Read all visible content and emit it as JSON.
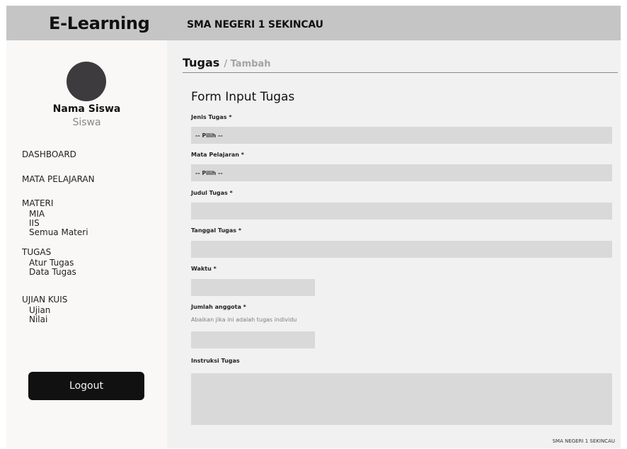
{
  "header": {
    "brand": "E-Learning",
    "school_name": "SMA NEGERI 1 SEKINCAU"
  },
  "sidebar": {
    "user_name": "Nama Siswa",
    "user_role": "Siswa",
    "menu": {
      "dashboard": "DASHBOARD",
      "mata_pelajaran": "MATA PELAJARAN",
      "materi": {
        "label": "MATERI",
        "items": [
          "MIA",
          "IIS",
          "Semua Materi"
        ]
      },
      "tugas": {
        "label": "TUGAS",
        "items": [
          "Atur Tugas",
          "Data Tugas"
        ]
      },
      "ujian_kuis": {
        "label": "UJIAN KUIS",
        "items": [
          "Ujian",
          "Nilai"
        ]
      }
    },
    "logout_label": "Logout"
  },
  "main": {
    "breadcrumb": {
      "current": "Tugas",
      "sub": "/ Tambah"
    },
    "form": {
      "title": "Form Input Tugas",
      "jenis_tugas": {
        "label": "Jenis Tugas *",
        "value": "-- Pilih --"
      },
      "mata_pelajaran": {
        "label": "Mata Pelajaran *",
        "value": "-- Pilih --"
      },
      "judul_tugas": {
        "label": "Judul Tugas *",
        "value": ""
      },
      "tanggal_tugas": {
        "label": "Tanggal Tugas *",
        "value": ""
      },
      "waktu": {
        "label": "Waktu *",
        "value": ""
      },
      "jumlah_anggota": {
        "label": "Jumlah anggota *",
        "hint": "Abaikan jika ini adalah tugas individu",
        "value": ""
      },
      "instruksi_tugas": {
        "label": "Instruksi Tugas",
        "value": ""
      }
    },
    "footer": "SMA NEGERI 1 SEKINCAU"
  }
}
